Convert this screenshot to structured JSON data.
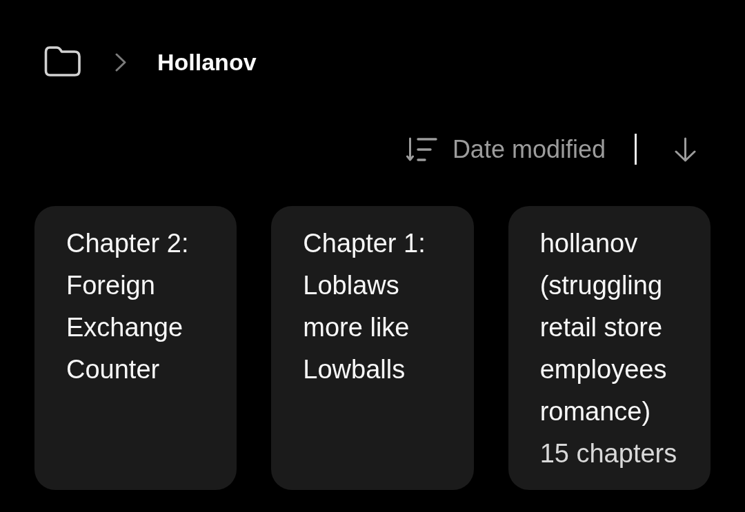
{
  "breadcrumb": {
    "title": "Hollanov"
  },
  "sort": {
    "label": "Date modified",
    "descending": true
  },
  "items": [
    {
      "title": "Chapter 2: Foreign Exchange Counter"
    },
    {
      "title": "Chapter 1: Loblaws more like Lowballs"
    },
    {
      "title": "hollanov (struggling retail store employees romance)",
      "subtitle": "15 chapters"
    }
  ]
}
